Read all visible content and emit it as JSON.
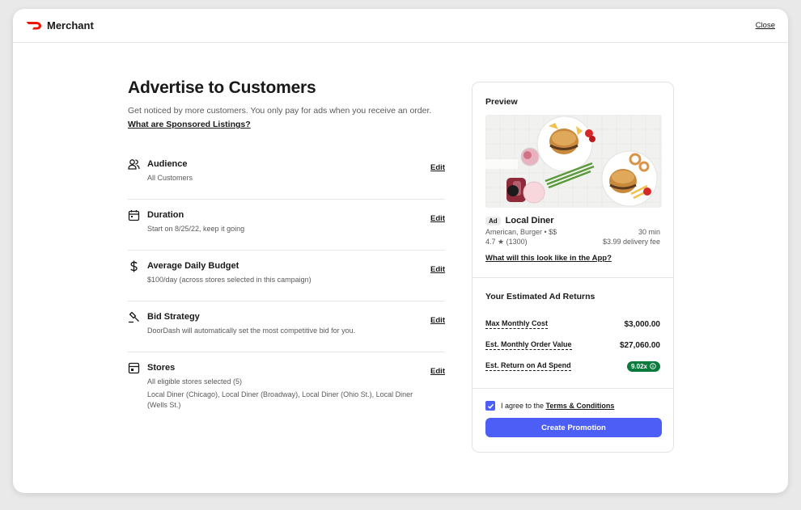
{
  "brand": {
    "name": "Merchant",
    "logo_color": "#eb1700"
  },
  "header": {
    "close_label": "Close"
  },
  "page": {
    "title": "Advertise to Customers",
    "subtitle": "Get noticed by more customers. You only pay for ads when you receive an order.",
    "help_link": "What are Sponsored Listings?"
  },
  "settings": [
    {
      "icon": "audience-icon",
      "label": "Audience",
      "value": "All Customers",
      "edit": "Edit"
    },
    {
      "icon": "calendar-icon",
      "label": "Duration",
      "value": "Start on 8/25/22, keep it going",
      "edit": "Edit"
    },
    {
      "icon": "dollar-icon",
      "label": "Average Daily Budget",
      "value": "$100/day (across stores selected in this campaign)",
      "edit": "Edit"
    },
    {
      "icon": "gavel-icon",
      "label": "Bid Strategy",
      "value": "DoorDash will automatically set the most competitive bid for you.",
      "edit": "Edit"
    },
    {
      "icon": "store-icon",
      "label": "Stores",
      "value": "All eligible stores selected (5)",
      "value2": "Local Diner (Chicago), Local Diner (Broadway), Local Diner (Ohio St.), Local Diner (Wells St.)",
      "edit": "Edit"
    }
  ],
  "preview": {
    "title": "Preview",
    "ad_badge": "Ad",
    "store_name": "Local Diner",
    "cuisine": "American, Burger • $$",
    "time": "30 min",
    "rating": "4.7 ★ (1300)",
    "delivery_fee": "$3.99 delivery fee",
    "app_link": "What will this look like in the App?"
  },
  "returns": {
    "title": "Your Estimated Ad Returns",
    "rows": [
      {
        "label": "Max Monthly Cost",
        "value": "$3,000.00"
      },
      {
        "label": "Est. Monthly Order Value",
        "value": "$27,060.00"
      },
      {
        "label": "Est. Return on Ad Spend",
        "value": "9.02x"
      }
    ],
    "roas_color": "#0a7a3d"
  },
  "footer": {
    "agree_prefix": "I agree to the ",
    "terms_link": "Terms & Conditions",
    "checked": true,
    "create_button": "Create Promotion",
    "accent": "#4c5ef5"
  }
}
